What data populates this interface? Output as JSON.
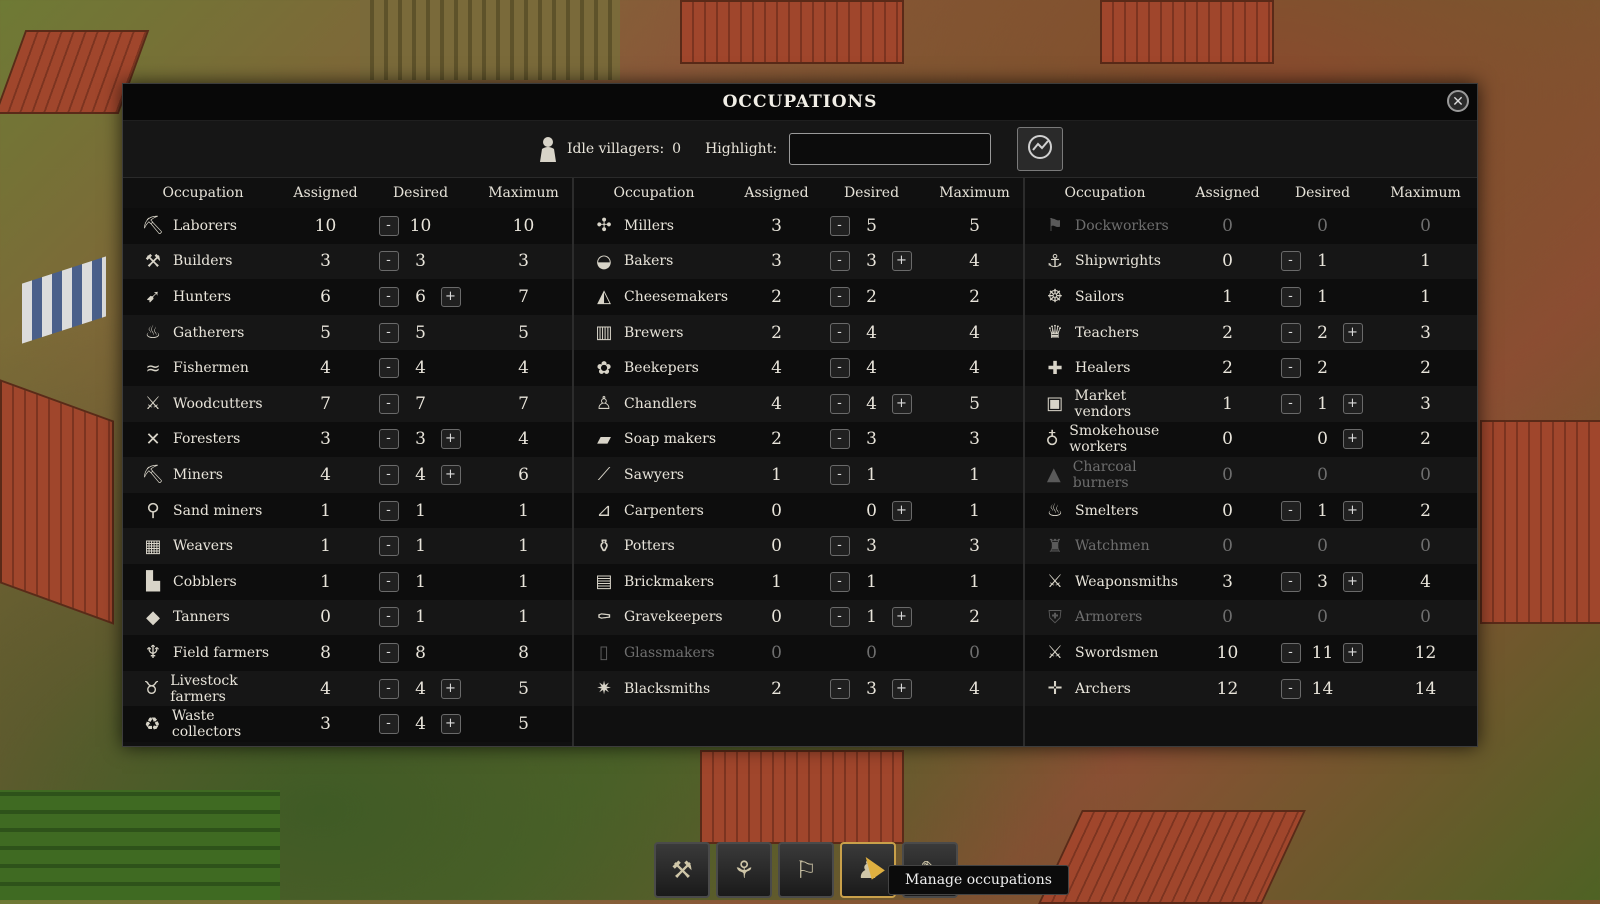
{
  "dialog": {
    "title": "OCCUPATIONS",
    "close_glyph": "✕",
    "idle_label": "Idle villagers:",
    "idle_value": "0",
    "highlight_label": "Highlight:",
    "highlight_value": ""
  },
  "headers": {
    "occupation": "Occupation",
    "assigned": "Assigned",
    "desired": "Desired",
    "maximum": "Maximum"
  },
  "columns": [
    [
      {
        "name": "Laborers",
        "icon": "laborer-icon",
        "glyph": "⛏",
        "assigned": "10",
        "desired": "10",
        "maximum": "10",
        "minus": true,
        "plus": false,
        "dim": false
      },
      {
        "name": "Builders",
        "icon": "hammer-icon",
        "glyph": "⚒",
        "assigned": "3",
        "desired": "3",
        "maximum": "3",
        "minus": true,
        "plus": false,
        "dim": false
      },
      {
        "name": "Hunters",
        "icon": "bow-icon",
        "glyph": "➹",
        "assigned": "6",
        "desired": "6",
        "maximum": "7",
        "minus": true,
        "plus": true,
        "dim": false
      },
      {
        "name": "Gatherers",
        "icon": "basket-icon",
        "glyph": "♨",
        "assigned": "5",
        "desired": "5",
        "maximum": "5",
        "minus": true,
        "plus": false,
        "dim": false
      },
      {
        "name": "Fishermen",
        "icon": "fish-icon",
        "glyph": "≈",
        "assigned": "4",
        "desired": "4",
        "maximum": "4",
        "minus": true,
        "plus": false,
        "dim": false
      },
      {
        "name": "Woodcutters",
        "icon": "axe-icon",
        "glyph": "⚔",
        "assigned": "7",
        "desired": "7",
        "maximum": "7",
        "minus": true,
        "plus": false,
        "dim": false
      },
      {
        "name": "Foresters",
        "icon": "tools-icon",
        "glyph": "✕",
        "assigned": "3",
        "desired": "3",
        "maximum": "4",
        "minus": true,
        "plus": true,
        "dim": false
      },
      {
        "name": "Miners",
        "icon": "pickaxe-icon",
        "glyph": "⛏",
        "assigned": "4",
        "desired": "4",
        "maximum": "6",
        "minus": true,
        "plus": true,
        "dim": false
      },
      {
        "name": "Sand miners",
        "icon": "shovel-icon",
        "glyph": "⚲",
        "assigned": "1",
        "desired": "1",
        "maximum": "1",
        "minus": true,
        "plus": false,
        "dim": false
      },
      {
        "name": "Weavers",
        "icon": "loom-icon",
        "glyph": "▦",
        "assigned": "1",
        "desired": "1",
        "maximum": "1",
        "minus": true,
        "plus": false,
        "dim": false
      },
      {
        "name": "Cobblers",
        "icon": "boot-icon",
        "glyph": "▙",
        "assigned": "1",
        "desired": "1",
        "maximum": "1",
        "minus": true,
        "plus": false,
        "dim": false
      },
      {
        "name": "Tanners",
        "icon": "hide-icon",
        "glyph": "◆",
        "assigned": "0",
        "desired": "1",
        "maximum": "1",
        "minus": true,
        "plus": false,
        "dim": false
      },
      {
        "name": "Field farmers",
        "icon": "wheat-icon",
        "glyph": "♆",
        "assigned": "8",
        "desired": "8",
        "maximum": "8",
        "minus": true,
        "plus": false,
        "dim": false
      },
      {
        "name": "Livestock farmers",
        "icon": "cow-icon",
        "glyph": "♉",
        "assigned": "4",
        "desired": "4",
        "maximum": "5",
        "minus": true,
        "plus": true,
        "dim": false
      },
      {
        "name": "Waste collectors",
        "icon": "waste-collector-icon",
        "glyph": "♻",
        "assigned": "3",
        "desired": "4",
        "maximum": "5",
        "minus": true,
        "plus": true,
        "dim": false
      }
    ],
    [
      {
        "name": "Millers",
        "icon": "windmill-icon",
        "glyph": "✣",
        "assigned": "3",
        "desired": "5",
        "maximum": "5",
        "minus": true,
        "plus": false,
        "dim": false
      },
      {
        "name": "Bakers",
        "icon": "bread-icon",
        "glyph": "◒",
        "assigned": "3",
        "desired": "3",
        "maximum": "4",
        "minus": true,
        "plus": true,
        "dim": false
      },
      {
        "name": "Cheesemakers",
        "icon": "cheese-icon",
        "glyph": "◭",
        "assigned": "2",
        "desired": "2",
        "maximum": "2",
        "minus": true,
        "plus": false,
        "dim": false
      },
      {
        "name": "Brewers",
        "icon": "barrel-icon",
        "glyph": "▥",
        "assigned": "2",
        "desired": "4",
        "maximum": "4",
        "minus": true,
        "plus": false,
        "dim": false
      },
      {
        "name": "Beekepers",
        "icon": "honeycomb-icon",
        "glyph": "✿",
        "assigned": "4",
        "desired": "4",
        "maximum": "4",
        "minus": true,
        "plus": false,
        "dim": false
      },
      {
        "name": "Chandlers",
        "icon": "candle-icon",
        "glyph": "♙",
        "assigned": "4",
        "desired": "4",
        "maximum": "5",
        "minus": true,
        "plus": true,
        "dim": false
      },
      {
        "name": "Soap makers",
        "icon": "soap-icon",
        "glyph": "▰",
        "assigned": "2",
        "desired": "3",
        "maximum": "3",
        "minus": true,
        "plus": false,
        "dim": false
      },
      {
        "name": "Sawyers",
        "icon": "saw-icon",
        "glyph": "⟋",
        "assigned": "1",
        "desired": "1",
        "maximum": "1",
        "minus": true,
        "plus": false,
        "dim": false
      },
      {
        "name": "Carpenters",
        "icon": "plane-icon",
        "glyph": "⊿",
        "assigned": "0",
        "desired": "0",
        "maximum": "1",
        "minus": false,
        "plus": true,
        "dim": false
      },
      {
        "name": "Potters",
        "icon": "pot-icon",
        "glyph": "⚱",
        "assigned": "0",
        "desired": "3",
        "maximum": "3",
        "minus": true,
        "plus": false,
        "dim": false
      },
      {
        "name": "Brickmakers",
        "icon": "bricks-icon",
        "glyph": "▤",
        "assigned": "1",
        "desired": "1",
        "maximum": "1",
        "minus": true,
        "plus": false,
        "dim": false
      },
      {
        "name": "Gravekeepers",
        "icon": "grave-shovel-icon",
        "glyph": "⚰",
        "assigned": "0",
        "desired": "1",
        "maximum": "2",
        "minus": true,
        "plus": true,
        "dim": false
      },
      {
        "name": "Glassmakers",
        "icon": "glass-icon",
        "glyph": "▯",
        "assigned": "0",
        "desired": "0",
        "maximum": "0",
        "minus": false,
        "plus": false,
        "dim": true
      },
      {
        "name": "Blacksmiths",
        "icon": "anvil-icon",
        "glyph": "✷",
        "assigned": "2",
        "desired": "3",
        "maximum": "4",
        "minus": true,
        "plus": true,
        "dim": false
      }
    ],
    [
      {
        "name": "Dockworkers",
        "icon": "dock-icon",
        "glyph": "⚑",
        "assigned": "0",
        "desired": "0",
        "maximum": "0",
        "minus": false,
        "plus": false,
        "dim": true
      },
      {
        "name": "Shipwrights",
        "icon": "anchor-icon",
        "glyph": "⚓",
        "assigned": "0",
        "desired": "1",
        "maximum": "1",
        "minus": true,
        "plus": false,
        "dim": false
      },
      {
        "name": "Sailors",
        "icon": "ship-wheel-icon",
        "glyph": "☸",
        "assigned": "1",
        "desired": "1",
        "maximum": "1",
        "minus": true,
        "plus": false,
        "dim": false
      },
      {
        "name": "Teachers",
        "icon": "graduation-cap-icon",
        "glyph": "♛",
        "assigned": "2",
        "desired": "2",
        "maximum": "3",
        "minus": true,
        "plus": true,
        "dim": false
      },
      {
        "name": "Healers",
        "icon": "healing-hands-icon",
        "glyph": "✚",
        "assigned": "2",
        "desired": "2",
        "maximum": "2",
        "minus": true,
        "plus": false,
        "dim": false
      },
      {
        "name": "Market vendors",
        "icon": "market-stall-icon",
        "glyph": "▣",
        "assigned": "1",
        "desired": "1",
        "maximum": "3",
        "minus": true,
        "plus": true,
        "dim": false
      },
      {
        "name": "Smokehouse workers",
        "icon": "smoked-meat-icon",
        "glyph": "♁",
        "assigned": "0",
        "desired": "0",
        "maximum": "2",
        "minus": false,
        "plus": true,
        "dim": false
      },
      {
        "name": "Charcoal burners",
        "icon": "charcoal-icon",
        "glyph": "▲",
        "assigned": "0",
        "desired": "0",
        "maximum": "0",
        "minus": false,
        "plus": false,
        "dim": true
      },
      {
        "name": "Smelters",
        "icon": "furnace-icon",
        "glyph": "♨",
        "assigned": "0",
        "desired": "1",
        "maximum": "2",
        "minus": true,
        "plus": true,
        "dim": false
      },
      {
        "name": "Watchmen",
        "icon": "watchtower-icon",
        "glyph": "♜",
        "assigned": "0",
        "desired": "0",
        "maximum": "0",
        "minus": false,
        "plus": false,
        "dim": true
      },
      {
        "name": "Weaponsmiths",
        "icon": "crossed-swords-icon",
        "glyph": "⚔",
        "assigned": "3",
        "desired": "3",
        "maximum": "4",
        "minus": true,
        "plus": true,
        "dim": false
      },
      {
        "name": "Armorers",
        "icon": "armor-icon",
        "glyph": "⛨",
        "assigned": "0",
        "desired": "0",
        "maximum": "0",
        "minus": false,
        "plus": false,
        "dim": true
      },
      {
        "name": "Swordsmen",
        "icon": "swords-icon",
        "glyph": "⚔",
        "assigned": "10",
        "desired": "11",
        "maximum": "12",
        "minus": true,
        "plus": true,
        "dim": false
      },
      {
        "name": "Archers",
        "icon": "crossbow-icon",
        "glyph": "✛",
        "assigned": "12",
        "desired": "14",
        "maximum": "14",
        "minus": true,
        "plus": false,
        "dim": false
      }
    ]
  ],
  "hotbar": [
    {
      "icon": "build-icon",
      "glyph": "⚒"
    },
    {
      "icon": "resources-icon",
      "glyph": "⚘"
    },
    {
      "icon": "tools-icon",
      "glyph": "⚐"
    },
    {
      "icon": "villagers-icon",
      "glyph": "♟"
    },
    {
      "icon": "policies-icon",
      "glyph": "✎"
    }
  ],
  "tooltip": "Manage occupations"
}
